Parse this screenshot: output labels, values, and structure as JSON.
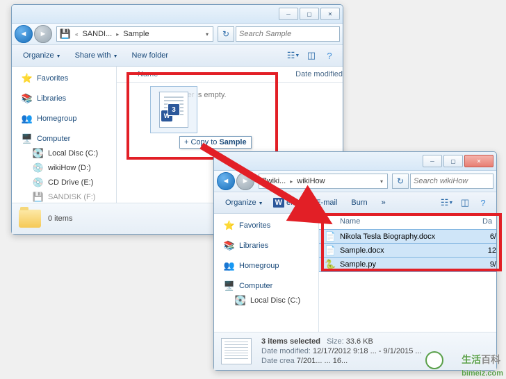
{
  "window1": {
    "breadcrumb": {
      "seg1": "SANDI...",
      "seg2": "Sample"
    },
    "search_placeholder": "Search Sample",
    "toolbar": {
      "organize": "Organize",
      "share": "Share with",
      "newfolder": "New folder"
    },
    "columns": {
      "name": "Name",
      "date": "Date modified"
    },
    "empty_msg": "This folder is empty.",
    "nav": {
      "favorites": "Favorites",
      "libraries": "Libraries",
      "homegroup": "Homegroup",
      "computer": "Computer",
      "drives": [
        "Local Disc (C:)",
        "wikiHow (D:)",
        "CD Drive (E:)",
        "SANDISK (F:)"
      ]
    },
    "status_count": "0 items",
    "drag": {
      "count": "3",
      "tooltip_prefix": "+ Copy to ",
      "tooltip_dest": "Sample"
    }
  },
  "window2": {
    "breadcrumb": {
      "seg1": "Zwiki...",
      "seg2": "wikiHow"
    },
    "search_placeholder": "Search wikiHow",
    "toolbar": {
      "organize": "Organize",
      "open": "en",
      "email": "E-mail",
      "burn": "Burn"
    },
    "columns": {
      "name": "Name",
      "date": "Da"
    },
    "nav": {
      "favorites": "Favorites",
      "libraries": "Libraries",
      "homegroup": "Homegroup",
      "computer": "Computer",
      "drives": [
        "Local Disc (C:)"
      ]
    },
    "files": [
      {
        "name": "Nikola Tesla Biography.docx",
        "date": "6/"
      },
      {
        "name": "Sample.docx",
        "date": "12"
      },
      {
        "name": "Sample.py",
        "date": "9/"
      }
    ],
    "status": {
      "title": "3 items selected",
      "size_lbl": "Size:",
      "size_val": "33.6 KB",
      "mod_lbl": "Date modified:",
      "mod_val": "12/17/2012 9:18 ... - 9/1/2015 ...",
      "crt_lbl": "Date crea",
      "crt_val": "7/201...  ...  16..."
    }
  },
  "watermark": "bimeiz.com"
}
